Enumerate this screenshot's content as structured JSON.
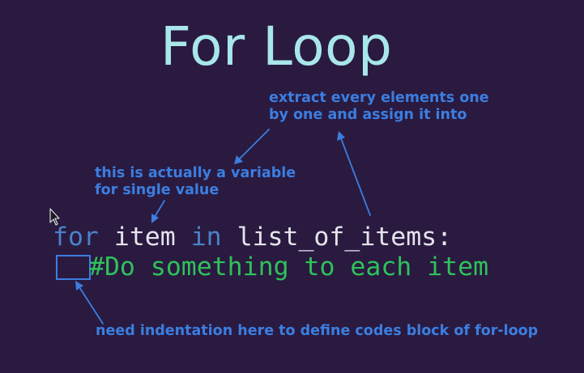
{
  "slide": {
    "title": "For Loop",
    "annotations": {
      "extract_line1": "extract every elements one",
      "extract_line2": "by one and assign it into",
      "variable_line1": "this is actually a variable",
      "variable_line2": "for single value",
      "indentation": "need indentation here to define codes block of for-loop"
    },
    "code": {
      "line1": {
        "kw_for": "for",
        "var": "item",
        "kw_in": "in",
        "iterable": "list_of_items:"
      },
      "line2": {
        "comment": "#Do something to each item"
      }
    }
  },
  "colors": {
    "background": "#2a1a40",
    "title": "#a8e6ea",
    "annotation": "#3b7ee0",
    "keyword": "#4a82c8",
    "identifier": "#e4e4ec",
    "comment": "#2ec25a"
  },
  "icons": [
    "mouse-pointer-icon",
    "arrow-icon"
  ]
}
